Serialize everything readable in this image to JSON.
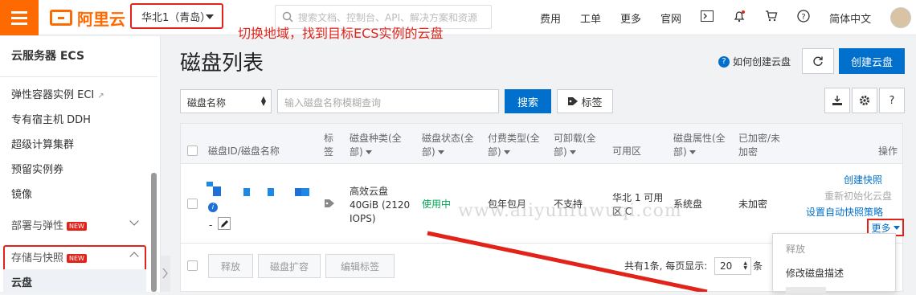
{
  "header": {
    "logo_text": "阿里云",
    "region": "华北1（青岛）",
    "search_placeholder": "搜索文档、控制台、API、解决方案和资源",
    "nav": [
      "费用",
      "工单",
      "更多",
      "官网"
    ],
    "language": "简体中文"
  },
  "annotation": "切换地域，找到目标ECS实例的云盘",
  "sidebar": {
    "title": "云服务器 ECS",
    "items": [
      {
        "label": "弹性容器实例 ECI"
      },
      {
        "label": "专有宿主机 DDH"
      },
      {
        "label": "超级计算集群"
      },
      {
        "label": "预留实例券"
      },
      {
        "label": "镜像"
      },
      {
        "label": "部署与弹性",
        "badge": "NEW"
      },
      {
        "label": "存储与快照",
        "badge": "NEW"
      },
      {
        "label": "云盘"
      }
    ]
  },
  "main": {
    "title": "磁盘列表",
    "help_link": "如何创建云盘",
    "create_button": "创建云盘",
    "filter": {
      "select_value": "磁盘名称",
      "input_placeholder": "输入磁盘名称模糊查询",
      "search_button": "搜索",
      "tag_button": "标签"
    },
    "tool_help": "?"
  },
  "table": {
    "headers": {
      "id": "磁盘ID/磁盘名称",
      "tag": "标签",
      "type": "磁盘种类(全部)",
      "status": "磁盘状态(全部)",
      "billing": "付费类型(全部)",
      "detach": "可卸载(全部)",
      "zone": "可用区",
      "attr": "磁盘属性(全部)",
      "encrypted": "已加密/未加密",
      "ops": "操作"
    },
    "row": {
      "id_suffix": "-",
      "type": "高效云盘 40GiB (2120 IOPS)",
      "status": "使用中",
      "billing": "包年包月",
      "detach": "不支持",
      "zone": "华北 1 可用区 C",
      "attr": "系统盘",
      "encrypted": "未加密",
      "ops": [
        "创建快照",
        "重新初始化云盘",
        "设置自动快照策略"
      ],
      "more": "更多"
    },
    "bulk_actions": [
      "释放",
      "磁盘扩容",
      "编辑标签"
    ],
    "pagination": {
      "summary": "共有1条, 每页显示:",
      "page_size": "20",
      "unit": "条"
    }
  },
  "more_menu": [
    "释放",
    "修改磁盘描述"
  ],
  "watermark": "www.aliyunfuwuqi.com",
  "colors": {
    "brand": "#ff6a00",
    "primary": "#0070cc",
    "highlight": "#e2231a",
    "status_ok": "#00a854"
  }
}
